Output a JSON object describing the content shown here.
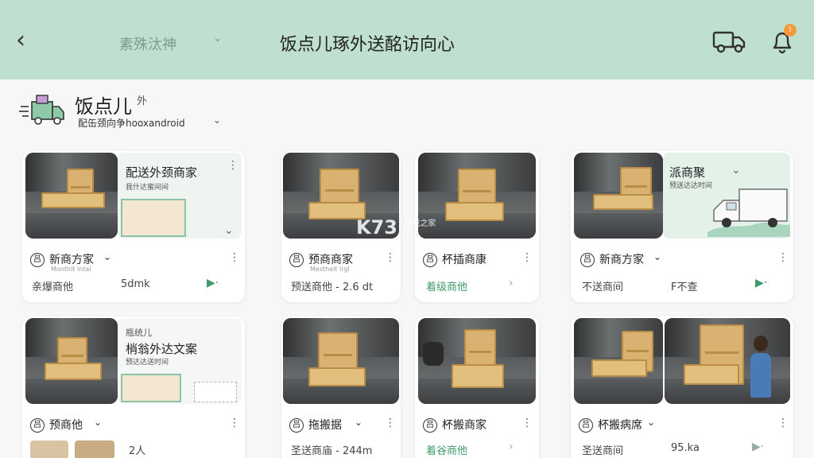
{
  "topbar": {
    "back_glyph": "‹",
    "subtitle": "素殊汰神",
    "title": "饭点儿琢外送酩访向心",
    "truck_icon": "truck-icon",
    "bell_icon": "bell-icon",
    "badge": "!"
  },
  "store": {
    "name": "饭点儿",
    "name_suffix": "外",
    "subtitle": "配缶颈向争hooxandroid",
    "colors": {
      "accent": "#3f9a69",
      "header": "#bfe0cf",
      "badge": "#f39a3a"
    }
  },
  "cards": [
    {
      "promo_title": "配送外颈商家",
      "promo_sub": "我什达蜜间间",
      "name": "新商方家",
      "tiny": "Monthlt lntal",
      "meta_left": "亲爆商他",
      "meta_right": "5dmk"
    },
    {
      "name": "预商商家",
      "tiny": "Mesthelt lrgl",
      "meta_left": "预送商他 - 2.6 dt"
    },
    {
      "name": "杯插商康",
      "meta_left": "着级商他"
    },
    {
      "promo_title": "派商聚",
      "promo_sub": "预送达达时间",
      "name": "新商方家",
      "meta_left": "不送商间",
      "meta_right": "F不查"
    },
    {
      "promo_title_top": "瓶统儿",
      "promo_title": "梢翁外达文案",
      "promo_sub": "预达达送时间",
      "name": "预商他",
      "meta_left": "2人"
    },
    {
      "name": "拖搬据",
      "meta_left": "圣送商庙 - 244m"
    },
    {
      "name": "杯搬商家",
      "meta_left": "着谷商他"
    },
    {
      "name": "杯搬病席",
      "meta_left": "圣送商间",
      "meta_right": "95.ka"
    }
  ],
  "watermark": {
    "text": "K73",
    "sub": "游戏之家"
  }
}
